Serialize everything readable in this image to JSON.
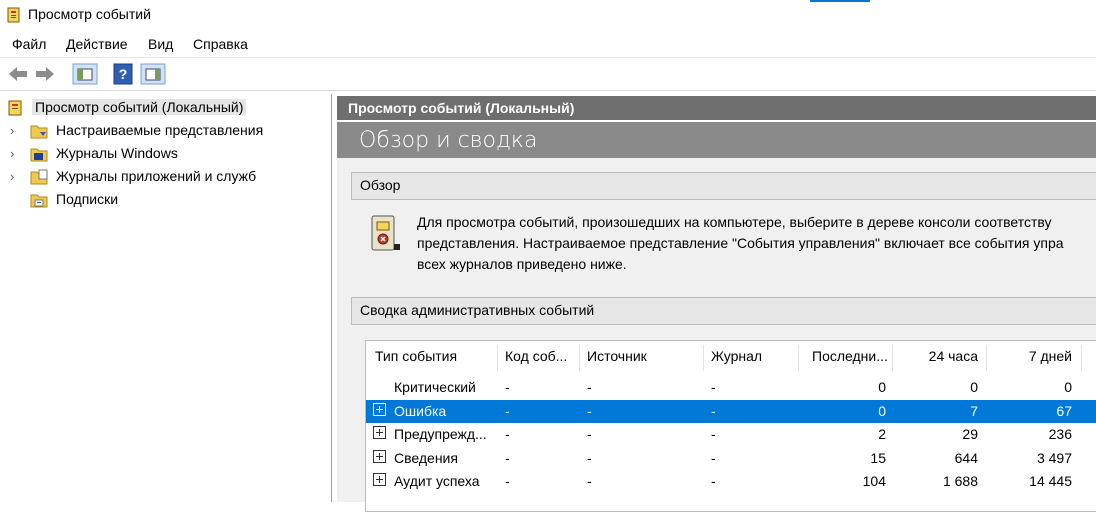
{
  "window": {
    "title": "Просмотр событий"
  },
  "menu": [
    "Файл",
    "Действие",
    "Вид",
    "Справка"
  ],
  "toolbar": {
    "icons": [
      "back-arrow-icon",
      "forward-arrow-icon",
      "show-hide-console-tree-icon",
      "help-icon",
      "show-hide-action-pane-icon"
    ]
  },
  "tree": {
    "root": "Просмотр событий (Локальный)",
    "items": [
      {
        "label": "Настраиваемые представления",
        "icon": "custom-views-folder-icon"
      },
      {
        "label": "Журналы Windows",
        "icon": "windows-logs-folder-icon"
      },
      {
        "label": "Журналы приложений и служб",
        "icon": "app-services-logs-folder-icon"
      },
      {
        "label": "Подписки",
        "icon": "subscriptions-icon"
      }
    ]
  },
  "main": {
    "header": "Просмотр событий (Локальный)",
    "subheader": "Обзор и сводка",
    "overview": {
      "title": "Обзор",
      "lines": [
        "Для просмотра событий, произошедших на компьютере, выберите в дереве консоли соответству",
        "представления. Настраиваемое представление \"События управления\" включает все события упра",
        "всех журналов приведено ниже."
      ]
    },
    "summary": {
      "title": "Сводка административных событий",
      "columns": [
        "Тип события",
        "Код соб...",
        "Источник",
        "Журнал",
        "Последни...",
        "24 часа",
        "7 дней"
      ],
      "rows": [
        {
          "type": "Критический",
          "code": "-",
          "source": "-",
          "log": "-",
          "last": "0",
          "h24": "0",
          "d7": "0",
          "expandable": false,
          "selected": false
        },
        {
          "type": "Ошибка",
          "code": "-",
          "source": "-",
          "log": "-",
          "last": "0",
          "h24": "7",
          "d7": "67",
          "expandable": true,
          "selected": true
        },
        {
          "type": "Предупрежд...",
          "code": "-",
          "source": "-",
          "log": "-",
          "last": "2",
          "h24": "29",
          "d7": "236",
          "expandable": true,
          "selected": false
        },
        {
          "type": "Сведения",
          "code": "-",
          "source": "-",
          "log": "-",
          "last": "15",
          "h24": "644",
          "d7": "3 497",
          "expandable": true,
          "selected": false
        },
        {
          "type": "Аудит успеха",
          "code": "-",
          "source": "-",
          "log": "-",
          "last": "104",
          "h24": "1 688",
          "d7": "14 445",
          "expandable": true,
          "selected": false
        }
      ]
    }
  },
  "colors": {
    "selection": "#0078d7",
    "header_dark": "#6e6e6e",
    "header_light": "#8a8a8a"
  }
}
